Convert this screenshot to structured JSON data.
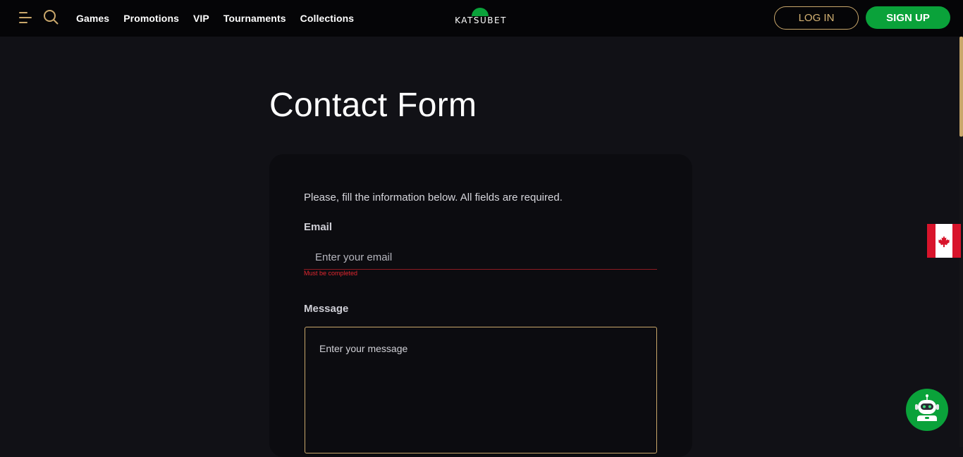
{
  "header": {
    "menu_icon": "hamburger-menu-icon",
    "search_icon": "search-icon",
    "nav": [
      {
        "label": "Games"
      },
      {
        "label": "Promotions"
      },
      {
        "label": "VIP"
      },
      {
        "label": "Tournaments"
      },
      {
        "label": "Collections"
      }
    ],
    "logo_text": "KATSUBET",
    "login_label": "LOG IN",
    "signup_label": "SIGN UP"
  },
  "main": {
    "title": "Contact Form",
    "intro": "Please, fill the information below. All fields are required.",
    "email": {
      "label": "Email",
      "placeholder": "Enter your email",
      "value": "",
      "error": "Must be completed"
    },
    "message": {
      "label": "Message",
      "placeholder": "Enter your message",
      "value": ""
    }
  },
  "widgets": {
    "language_flag": "canada-flag-icon",
    "chat": "chatbot-robot-icon"
  },
  "colors": {
    "accent_gold": "#c9a76b",
    "brand_green": "#0aa23a",
    "error_red": "#e0272f",
    "background": "#111116"
  }
}
